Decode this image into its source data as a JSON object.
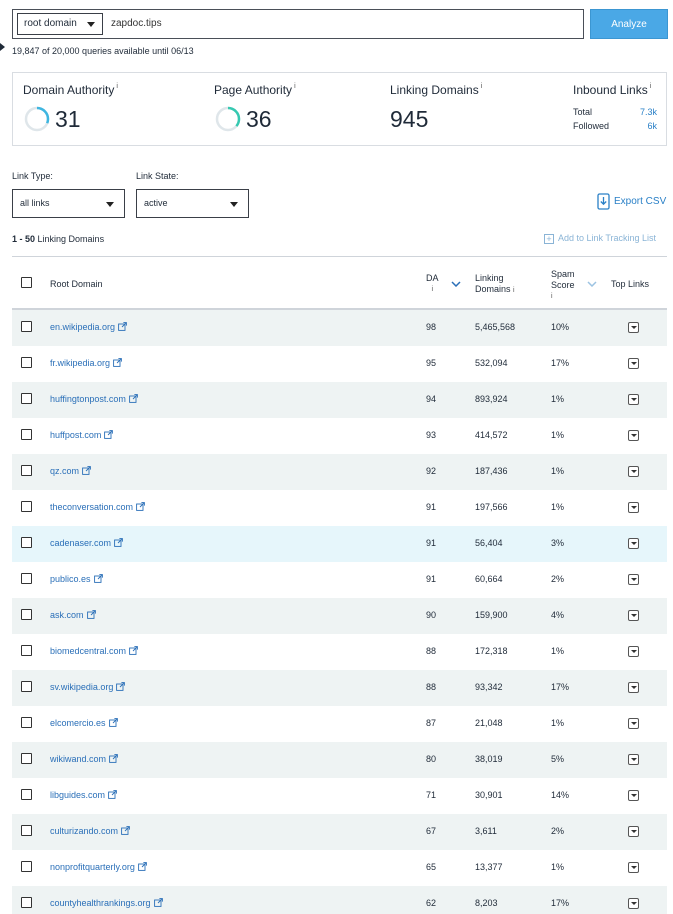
{
  "search": {
    "scope_select": "root domain",
    "query": "zapdoc.tips",
    "analyze_label": "Analyze",
    "queries_note": "19,847 of 20,000 queries available until 06/13"
  },
  "metrics": {
    "domain_authority": {
      "label": "Domain Authority",
      "info": "i",
      "value": "31",
      "gauge_fraction": 0.31,
      "gauge_color": "#3fb6e0"
    },
    "page_authority": {
      "label": "Page Authority",
      "info": "i",
      "value": "36",
      "gauge_fraction": 0.36,
      "gauge_color": "#36c9b1"
    },
    "linking_domains": {
      "label": "Linking Domains",
      "info": "i",
      "value": "945"
    },
    "inbound_links": {
      "label": "Inbound Links",
      "info": "i",
      "total_label": "Total",
      "total_value": "7.3k",
      "followed_label": "Followed",
      "followed_value": "6k"
    }
  },
  "filters": {
    "link_type_label": "Link Type:",
    "link_type_value": "all links",
    "link_state_label": "Link State:",
    "link_state_value": "active",
    "export_label": "Export CSV"
  },
  "list": {
    "range": "1 - 50",
    "range_suffix": "Linking Domains",
    "tracking_label": "Add to Link Tracking List"
  },
  "table": {
    "headers": {
      "root_domain": "Root Domain",
      "da": "DA",
      "linking_domains_line1": "Linking",
      "linking_domains_line2": "Domains",
      "spam_line1": "Spam",
      "spam_line2": "Score",
      "top_links": "Top Links",
      "info": "i"
    },
    "rows": [
      {
        "domain": "en.wikipedia.org",
        "da": "98",
        "linking": "5,465,568",
        "spam": "10%"
      },
      {
        "domain": "fr.wikipedia.org",
        "da": "95",
        "linking": "532,094",
        "spam": "17%"
      },
      {
        "domain": "huffingtonpost.com",
        "da": "94",
        "linking": "893,924",
        "spam": "1%"
      },
      {
        "domain": "huffpost.com",
        "da": "93",
        "linking": "414,572",
        "spam": "1%"
      },
      {
        "domain": "qz.com",
        "da": "92",
        "linking": "187,436",
        "spam": "1%"
      },
      {
        "domain": "theconversation.com",
        "da": "91",
        "linking": "197,566",
        "spam": "1%"
      },
      {
        "domain": "cadenaser.com",
        "da": "91",
        "linking": "56,404",
        "spam": "3%",
        "highlighted": true
      },
      {
        "domain": "publico.es",
        "da": "91",
        "linking": "60,664",
        "spam": "2%"
      },
      {
        "domain": "ask.com",
        "da": "90",
        "linking": "159,900",
        "spam": "4%"
      },
      {
        "domain": "biomedcentral.com",
        "da": "88",
        "linking": "172,318",
        "spam": "1%"
      },
      {
        "domain": "sv.wikipedia.org",
        "da": "88",
        "linking": "93,342",
        "spam": "17%"
      },
      {
        "domain": "elcomercio.es",
        "da": "87",
        "linking": "21,048",
        "spam": "1%"
      },
      {
        "domain": "wikiwand.com",
        "da": "80",
        "linking": "38,019",
        "spam": "5%"
      },
      {
        "domain": "libguides.com",
        "da": "71",
        "linking": "30,901",
        "spam": "14%"
      },
      {
        "domain": "culturizando.com",
        "da": "67",
        "linking": "3,611",
        "spam": "2%"
      },
      {
        "domain": "nonprofitquarterly.org",
        "da": "65",
        "linking": "13,377",
        "spam": "1%"
      },
      {
        "domain": "countyhealthrankings.org",
        "da": "62",
        "linking": "8,203",
        "spam": "17%"
      }
    ]
  }
}
